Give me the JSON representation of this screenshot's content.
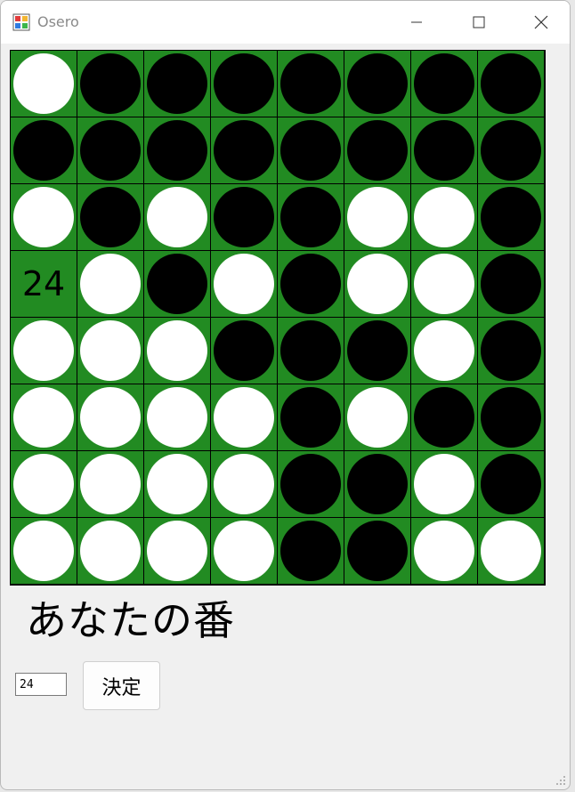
{
  "window": {
    "title": "Osero",
    "controls": [
      "minimize-icon",
      "maximize-icon",
      "close-icon"
    ]
  },
  "board": {
    "size": 8,
    "colors": {
      "board": "#228b22",
      "grid": "#000000",
      "black": "#000000",
      "white": "#ffffff"
    },
    "rows": [
      [
        "W",
        "B",
        "B",
        "B",
        "B",
        "B",
        "B",
        "B"
      ],
      [
        "B",
        "B",
        "B",
        "B",
        "B",
        "B",
        "B",
        "B"
      ],
      [
        "W",
        "B",
        "W",
        "B",
        "B",
        "W",
        "W",
        "B"
      ],
      [
        "24",
        "W",
        "B",
        "W",
        "B",
        "W",
        "W",
        "B"
      ],
      [
        "W",
        "W",
        "W",
        "B",
        "B",
        "B",
        "W",
        "B"
      ],
      [
        "W",
        "W",
        "W",
        "W",
        "B",
        "W",
        "B",
        "B"
      ],
      [
        "W",
        "W",
        "W",
        "W",
        "B",
        "B",
        "W",
        "B"
      ],
      [
        "W",
        "W",
        "W",
        "W",
        "B",
        "B",
        "W",
        "W"
      ]
    ]
  },
  "status": {
    "turn_text": "あなたの番"
  },
  "controls": {
    "move_input_value": "24",
    "decide_label": "決定"
  }
}
